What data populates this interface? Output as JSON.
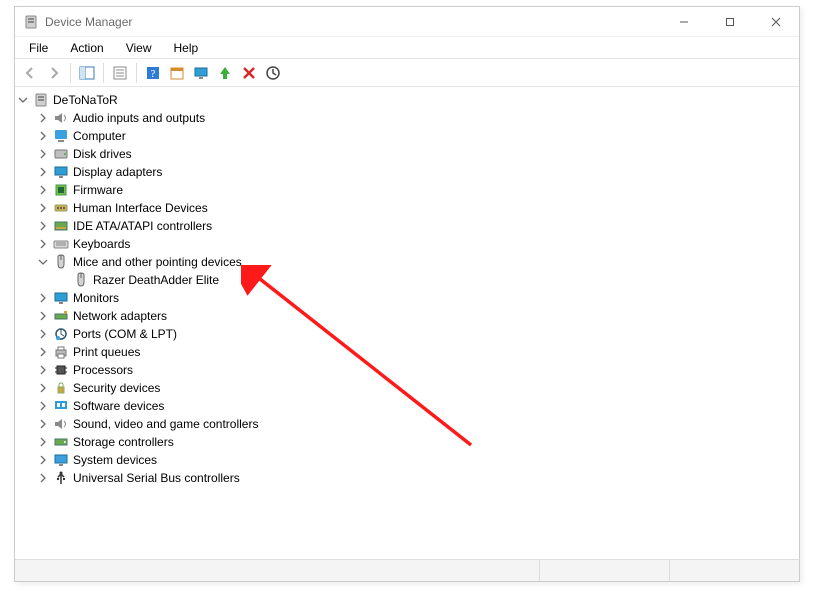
{
  "window": {
    "title": "Device Manager"
  },
  "menu": {
    "file": "File",
    "action": "Action",
    "view": "View",
    "help": "Help"
  },
  "toolbar": {
    "back": "Back",
    "forward": "Forward",
    "show_hide_tree": "Show/Hide Console Tree",
    "properties": "Properties",
    "help": "Help",
    "action_center": "Show Action",
    "update": "Update driver",
    "uninstall": "Uninstall device",
    "delete": "Delete",
    "scan": "Scan for hardware changes"
  },
  "tree": {
    "root": "DeToNaToR",
    "categories": [
      {
        "label": "Audio inputs and outputs",
        "icon": "audio",
        "expanded": false,
        "expandable": true
      },
      {
        "label": "Computer",
        "icon": "computer",
        "expanded": false,
        "expandable": true
      },
      {
        "label": "Disk drives",
        "icon": "disk",
        "expanded": false,
        "expandable": true
      },
      {
        "label": "Display adapters",
        "icon": "display",
        "expanded": false,
        "expandable": true
      },
      {
        "label": "Firmware",
        "icon": "firmware",
        "expanded": false,
        "expandable": true
      },
      {
        "label": "Human Interface Devices",
        "icon": "hid",
        "expanded": false,
        "expandable": true
      },
      {
        "label": "IDE ATA/ATAPI controllers",
        "icon": "ide",
        "expanded": false,
        "expandable": true
      },
      {
        "label": "Keyboards",
        "icon": "keyboard",
        "expanded": false,
        "expandable": true
      },
      {
        "label": "Mice and other pointing devices",
        "icon": "mouse",
        "expanded": true,
        "expandable": true,
        "children": [
          {
            "label": "Razer DeathAdder Elite",
            "icon": "mouse"
          }
        ]
      },
      {
        "label": "Monitors",
        "icon": "monitor",
        "expanded": false,
        "expandable": true
      },
      {
        "label": "Network adapters",
        "icon": "network",
        "expanded": false,
        "expandable": true
      },
      {
        "label": "Ports (COM & LPT)",
        "icon": "ports",
        "expanded": false,
        "expandable": true
      },
      {
        "label": "Print queues",
        "icon": "printer",
        "expanded": false,
        "expandable": true
      },
      {
        "label": "Processors",
        "icon": "cpu",
        "expanded": false,
        "expandable": true
      },
      {
        "label": "Security devices",
        "icon": "security",
        "expanded": false,
        "expandable": true
      },
      {
        "label": "Software devices",
        "icon": "software",
        "expanded": false,
        "expandable": true
      },
      {
        "label": "Sound, video and game controllers",
        "icon": "audio",
        "expanded": false,
        "expandable": true
      },
      {
        "label": "Storage controllers",
        "icon": "storage",
        "expanded": false,
        "expandable": true
      },
      {
        "label": "System devices",
        "icon": "system",
        "expanded": false,
        "expandable": true
      },
      {
        "label": "Universal Serial Bus controllers",
        "icon": "usb",
        "expanded": false,
        "expandable": true
      }
    ]
  }
}
